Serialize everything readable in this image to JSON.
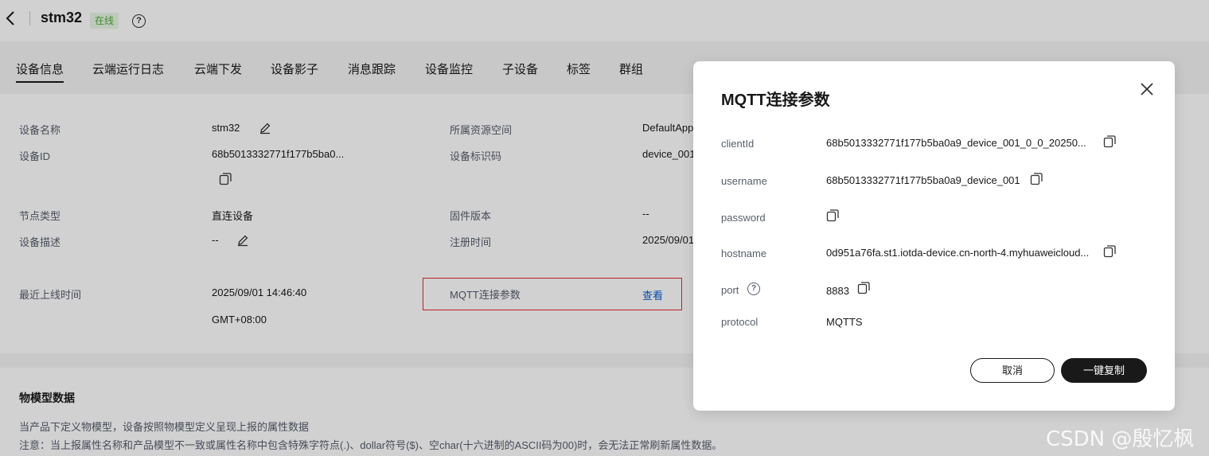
{
  "header": {
    "device_name": "stm32",
    "status": "在线",
    "help": "?"
  },
  "tabs": [
    "设备信息",
    "云端运行日志",
    "云端下发",
    "设备影子",
    "消息跟踪",
    "设备监控",
    "子设备",
    "标签",
    "群组"
  ],
  "info": {
    "device_name_label": "设备名称",
    "device_name_value": "stm32",
    "device_id_label": "设备ID",
    "device_id_value": "68b5013332771f177b5ba0...",
    "node_type_label": "节点类型",
    "node_type_value": "直连设备",
    "description_label": "设备描述",
    "description_value": "--",
    "last_online_label": "最近上线时间",
    "last_online_value": "2025/09/01 14:46:40",
    "last_online_tz": "GMT+08:00",
    "resource_space_label": "所属资源空间",
    "resource_space_value": "DefaultApp",
    "identifier_label": "设备标识码",
    "identifier_value": "device_001",
    "firmware_label": "固件版本",
    "firmware_value": "--",
    "register_label": "注册时间",
    "register_value": "2025/09/01",
    "mqtt_label": "MQTT连接参数",
    "mqtt_link": "查看"
  },
  "model_section": {
    "title": "物模型数据",
    "line1": "当产品下定义物模型，设备按照物模型定义呈现上报的属性数据",
    "line2": "注意：当上报属性名称和产品模型不一致或属性名称中包含特殊字符点(.)、dollar符号($)、空char(十六进制的ASCII码为00)时，会无法正常刷新属性数据。"
  },
  "dialog": {
    "title": "MQTT连接参数",
    "params": {
      "clientId_label": "clientId",
      "clientId_value": "68b5013332771f177b5ba0a9_device_001_0_0_20250...",
      "username_label": "username",
      "username_value": "68b5013332771f177b5ba0a9_device_001",
      "password_label": "password",
      "hostname_label": "hostname",
      "hostname_value": "0d951a76fa.st1.iotda-device.cn-north-4.myhuaweicloud...",
      "port_label": "port",
      "port_value": "8883",
      "protocol_label": "protocol",
      "protocol_value": "MQTTS"
    },
    "cancel_label": "取消",
    "copy_all_label": "一键复制",
    "question": "?"
  },
  "watermark": "CSDN @殷忆枫",
  "colors": {
    "accent_link": "#0a5cd3",
    "status_green": "#4bab35",
    "highlight_red": "#e6262c",
    "primary_button": "#191919"
  }
}
